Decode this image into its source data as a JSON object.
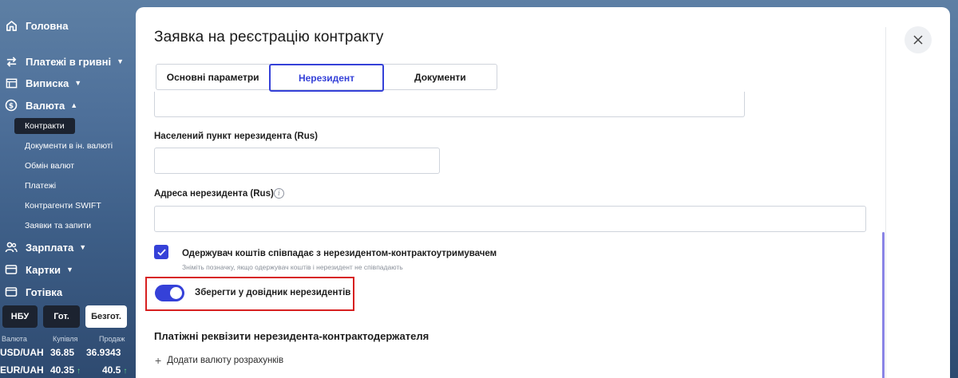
{
  "sidebar": {
    "home": "Головна",
    "payments_uah": "Платежі в гривні",
    "statement": "Виписка",
    "currency": "Валюта",
    "sub_items": [
      "Контракти",
      "Документи в ін. валюті",
      "Обмін валют",
      "Платежі",
      "Контрагенти SWIFT",
      "Заявки та запити"
    ],
    "salary": "Зарплата",
    "cards": "Картки",
    "cash": "Готівка",
    "rate_buttons": [
      "НБУ",
      "Гот.",
      "Безгот."
    ],
    "rates_header": {
      "currency": "Валюта",
      "buy": "Купівля",
      "sell": "Продаж"
    },
    "rates": [
      {
        "pair": "USD/UAH",
        "buy": "36.85",
        "sell": "36.9343"
      },
      {
        "pair": "EUR/UAH",
        "buy": "40.35",
        "sell": "40.5"
      }
    ]
  },
  "modal": {
    "title": "Заявка на реєстрацію контракту",
    "tabs": [
      "Основні параметри",
      "Нерезидент",
      "Документи"
    ],
    "active_tab": "Нерезидент",
    "fields": {
      "locality_label": "Населений пункт нерезидента (Rus)",
      "locality_value": "",
      "address_label": "Адреса нерезидента (Rus)",
      "address_value": ""
    },
    "checkbox_label": "Одержувач коштів співпадає з нерезидентом-контрактоутримувачем",
    "checkbox_hint": "Зніміть позначку, якщо одержувач коштів і нерезидент не співпадають",
    "checkbox_checked": true,
    "toggle_label": "Зберегти у довідник нерезидентів",
    "toggle_on": true,
    "section_title": "Платіжні реквізити нерезидента-контрактодержателя",
    "add_link": "Додати валюту розрахунків"
  },
  "colors": {
    "accent": "#3541d8",
    "highlight": "#d72020"
  },
  "icons": [
    "home-icon",
    "transfer-icon",
    "statement-icon",
    "dollar-icon",
    "people-icon",
    "card-icon",
    "wallet-icon",
    "close-icon",
    "info-icon",
    "check-icon",
    "plus-icon"
  ]
}
